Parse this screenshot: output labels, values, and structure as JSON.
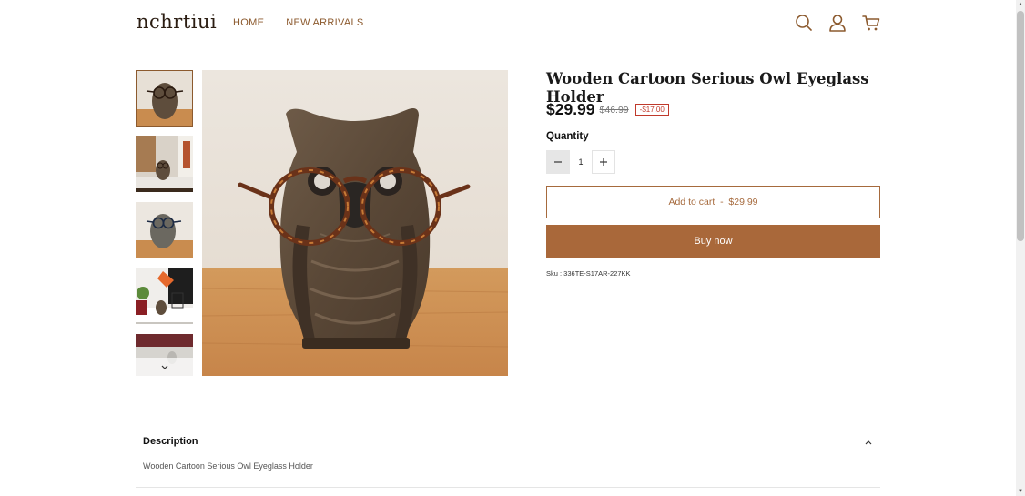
{
  "header": {
    "logo": "nchrtiui",
    "nav": [
      "HOME",
      "NEW ARRIVALS"
    ],
    "icons": [
      "search-icon",
      "account-icon",
      "cart-icon"
    ]
  },
  "gallery": {
    "thumbnail_count": 5,
    "selected_index": 0
  },
  "product": {
    "title": "Wooden Cartoon Serious Owl Eyeglass Holder",
    "price": "$29.99",
    "compare_price": "$46.99",
    "discount_badge": "-$17.00",
    "quantity_label": "Quantity",
    "quantity_value": "1",
    "add_to_cart_label": "Add to cart  -  $29.99",
    "buy_now_label": "Buy now",
    "sku": "Sku : 336TE-S17AR-227KK"
  },
  "description": {
    "title": "Description",
    "text": "Wooden Cartoon Serious Owl Eyeglass Holder"
  },
  "colors": {
    "accent": "#a9683a",
    "nav": "#8c5a2e",
    "badge": "#c0392b"
  }
}
